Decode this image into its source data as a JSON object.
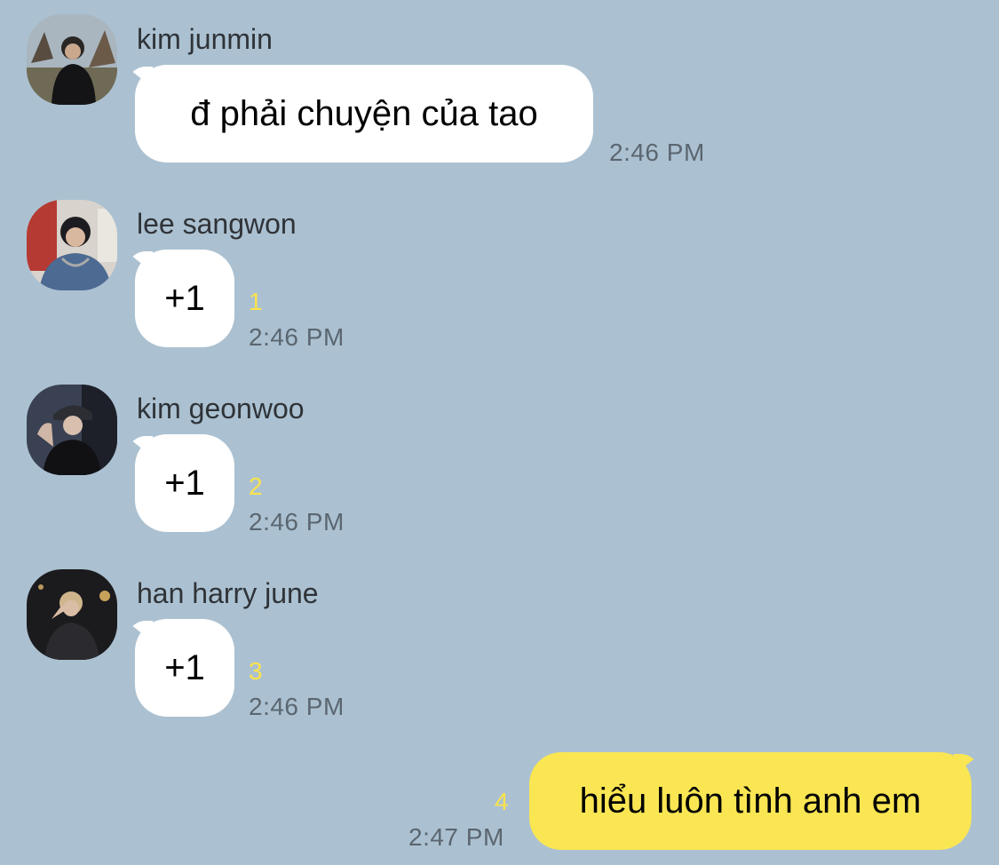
{
  "messages": [
    {
      "sender": "kim junmin",
      "text": "đ phải chuyện của tao",
      "time": "2:46 PM",
      "unread": ""
    },
    {
      "sender": "lee sangwon",
      "text": "+1",
      "time": "2:46 PM",
      "unread": "1"
    },
    {
      "sender": "kim geonwoo",
      "text": "+1",
      "time": "2:46 PM",
      "unread": "2"
    },
    {
      "sender": "han harry june",
      "text": "+1",
      "time": "2:46 PM",
      "unread": "3"
    }
  ],
  "outgoing": {
    "text": "hiểu luôn tình anh em",
    "time": "2:47 PM",
    "unread": "4"
  },
  "colors": {
    "background": "#abc1d1",
    "incoming_bubble": "#ffffff",
    "outgoing_bubble": "#fae653",
    "unread_count": "#fae34c"
  }
}
